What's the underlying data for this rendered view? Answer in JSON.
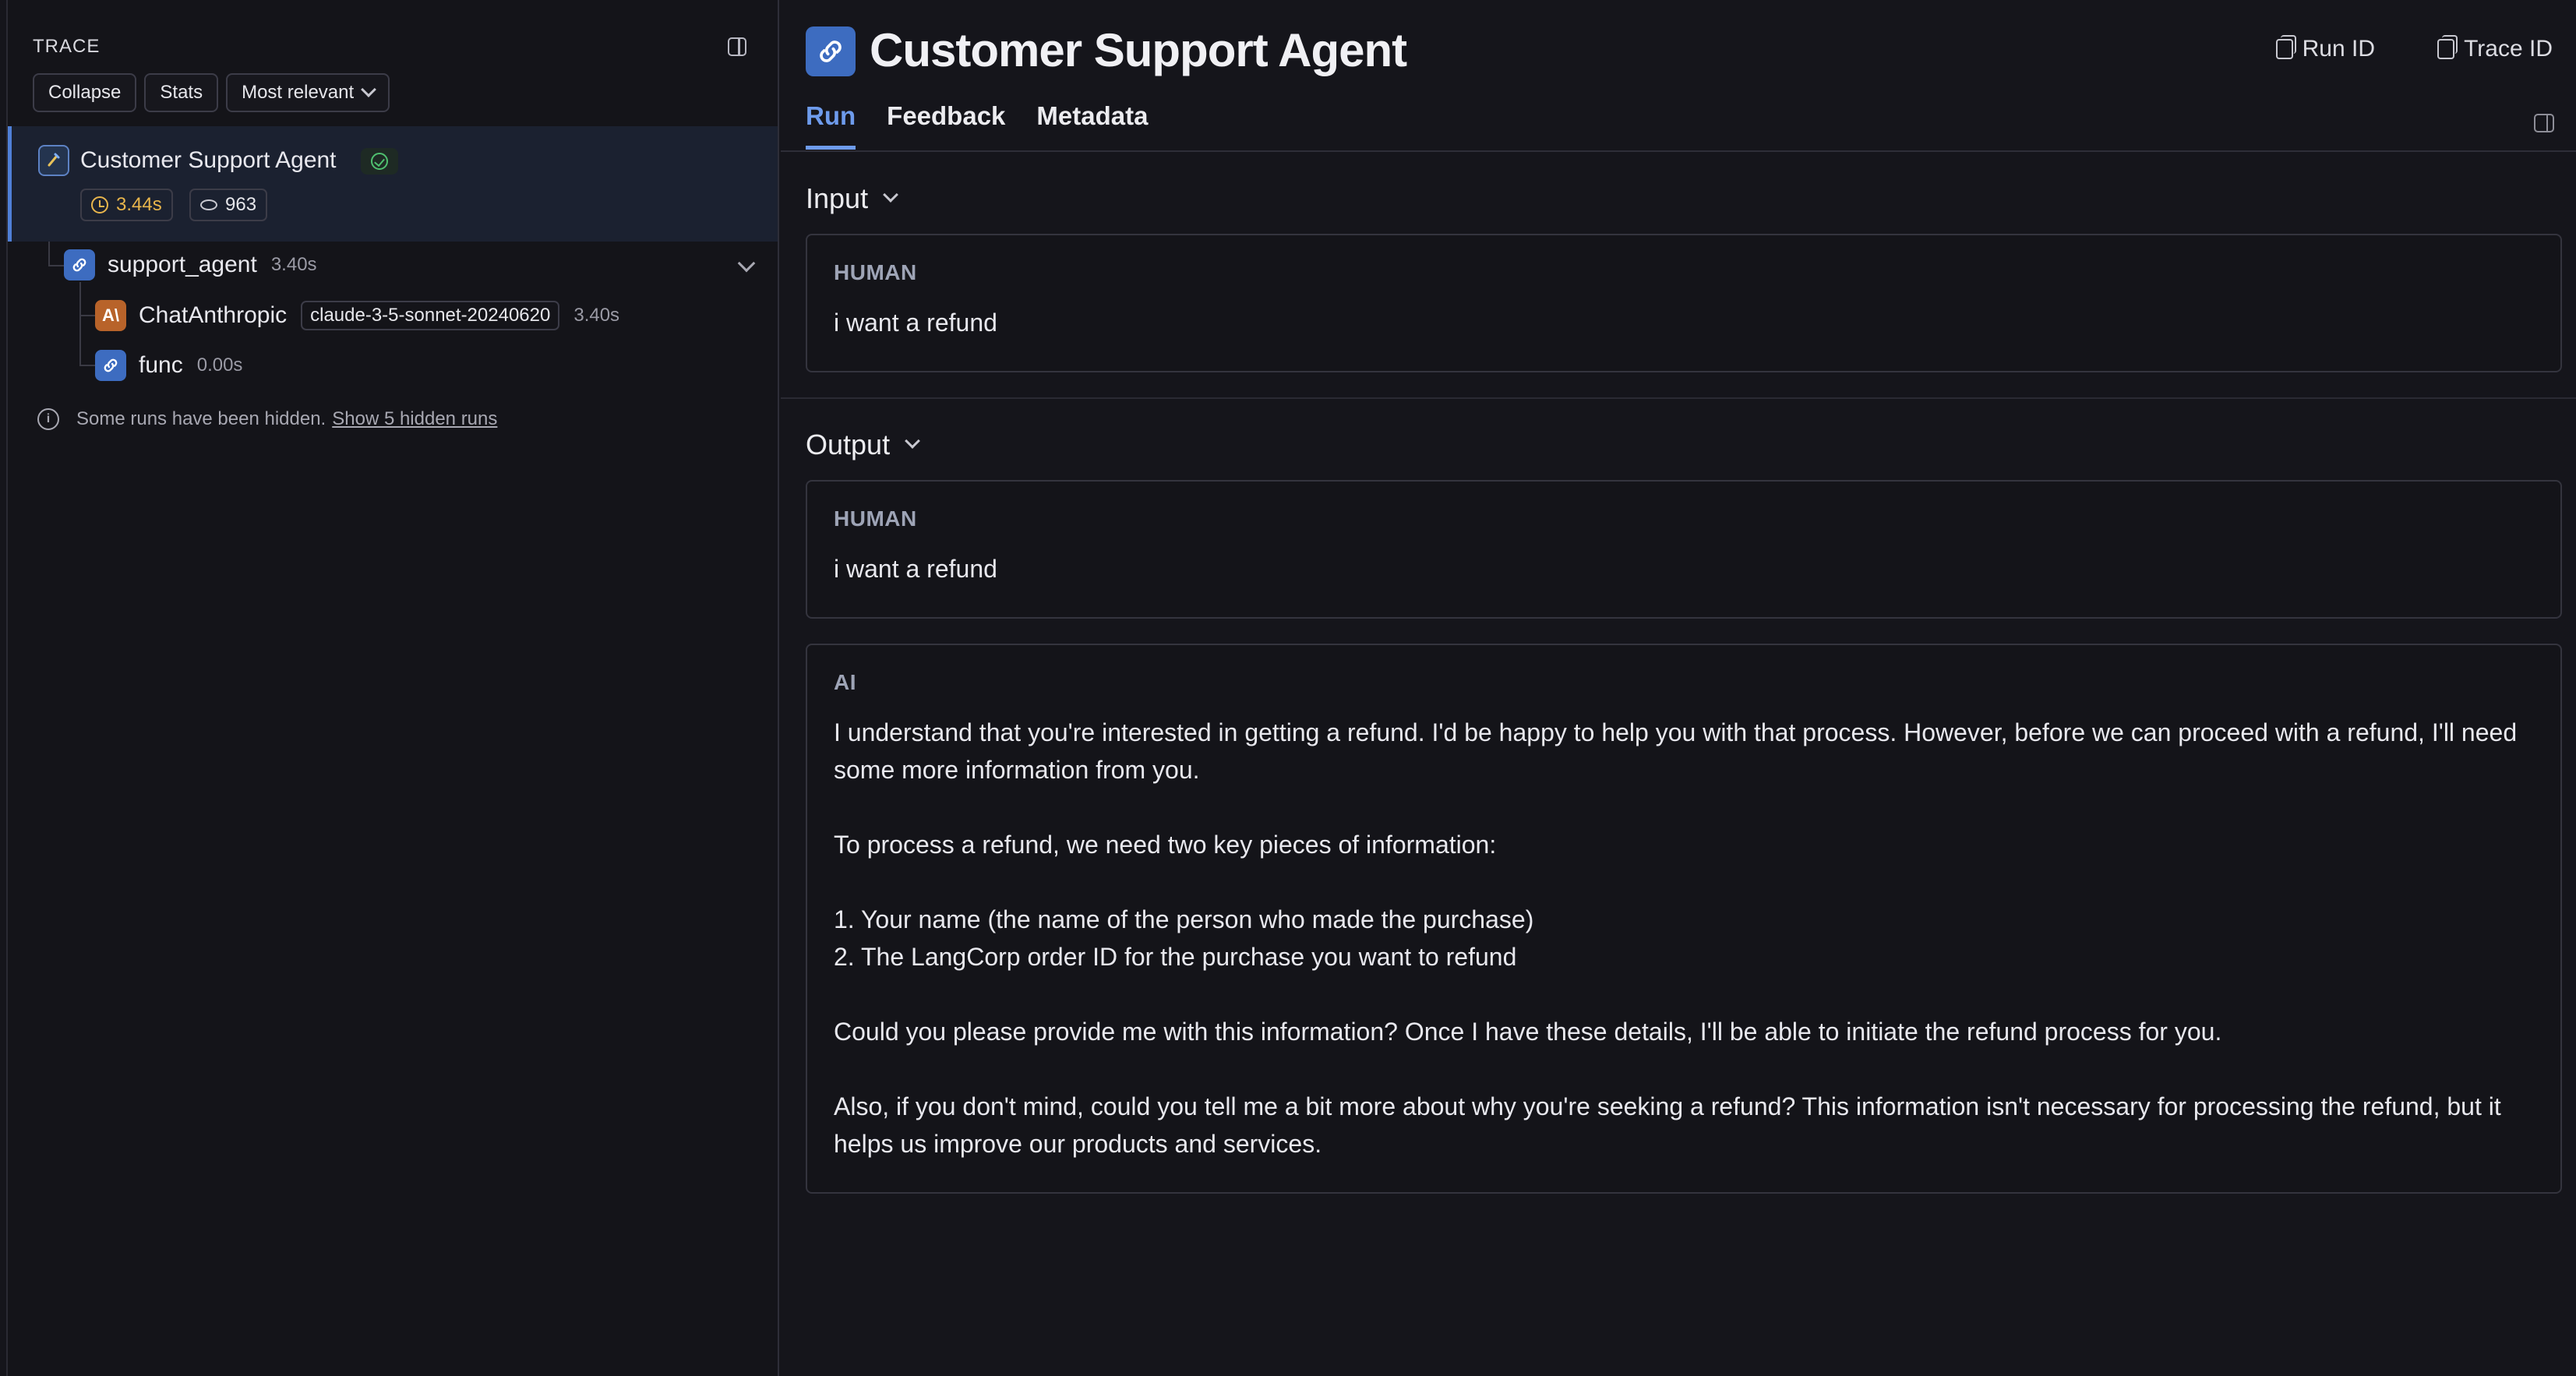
{
  "trace_panel": {
    "title": "TRACE",
    "controls": {
      "collapse": "Collapse",
      "stats": "Stats",
      "sort": "Most relevant"
    },
    "root_run": {
      "name": "Customer Support Agent",
      "latency": "3.44s",
      "tokens": "963"
    },
    "children": [
      {
        "name": "support_agent",
        "time": "3.40s",
        "icon": "chain-link-icon"
      },
      {
        "name": "ChatAnthropic",
        "model": "claude-3-5-sonnet-20240620",
        "time": "3.40s",
        "icon": "anthropic-icon",
        "icon_glyph": "A\\"
      },
      {
        "name": "func",
        "time": "0.00s",
        "icon": "chain-link-icon"
      }
    ],
    "hidden_note": {
      "text": "Some runs have been hidden.",
      "link": "Show 5 hidden runs"
    }
  },
  "detail": {
    "title": "Customer Support Agent",
    "run_id_label": "Run ID",
    "trace_id_label": "Trace ID",
    "tabs": [
      "Run",
      "Feedback",
      "Metadata"
    ],
    "active_tab": "Run",
    "input": {
      "label": "Input",
      "messages": [
        {
          "role": "HUMAN",
          "text": "i want a refund"
        }
      ]
    },
    "output": {
      "label": "Output",
      "messages": [
        {
          "role": "HUMAN",
          "text": "i want a refund"
        },
        {
          "role": "AI",
          "text": "I understand that you're interested in getting a refund. I'd be happy to help you with that process. However, before we can proceed with a refund, I'll need some more information from you.\n\nTo process a refund, we need two key pieces of information:\n\n1. Your name (the name of the person who made the purchase)\n2. The LangCorp order ID for the purchase you want to refund\n\nCould you please provide me with this information? Once I have these details, I'll be able to initiate the refund process for you.\n\nAlso, if you don't mind, could you tell me a bit more about why you're seeking a refund? This information isn't necessary for processing the refund, but it helps us improve our products and services."
        }
      ]
    }
  },
  "colors": {
    "accent": "#6e9bec",
    "success": "#4fbf6f",
    "latency": "#e8b54c",
    "chain": "#3d6cc0",
    "anthropic": "#b8632a"
  }
}
